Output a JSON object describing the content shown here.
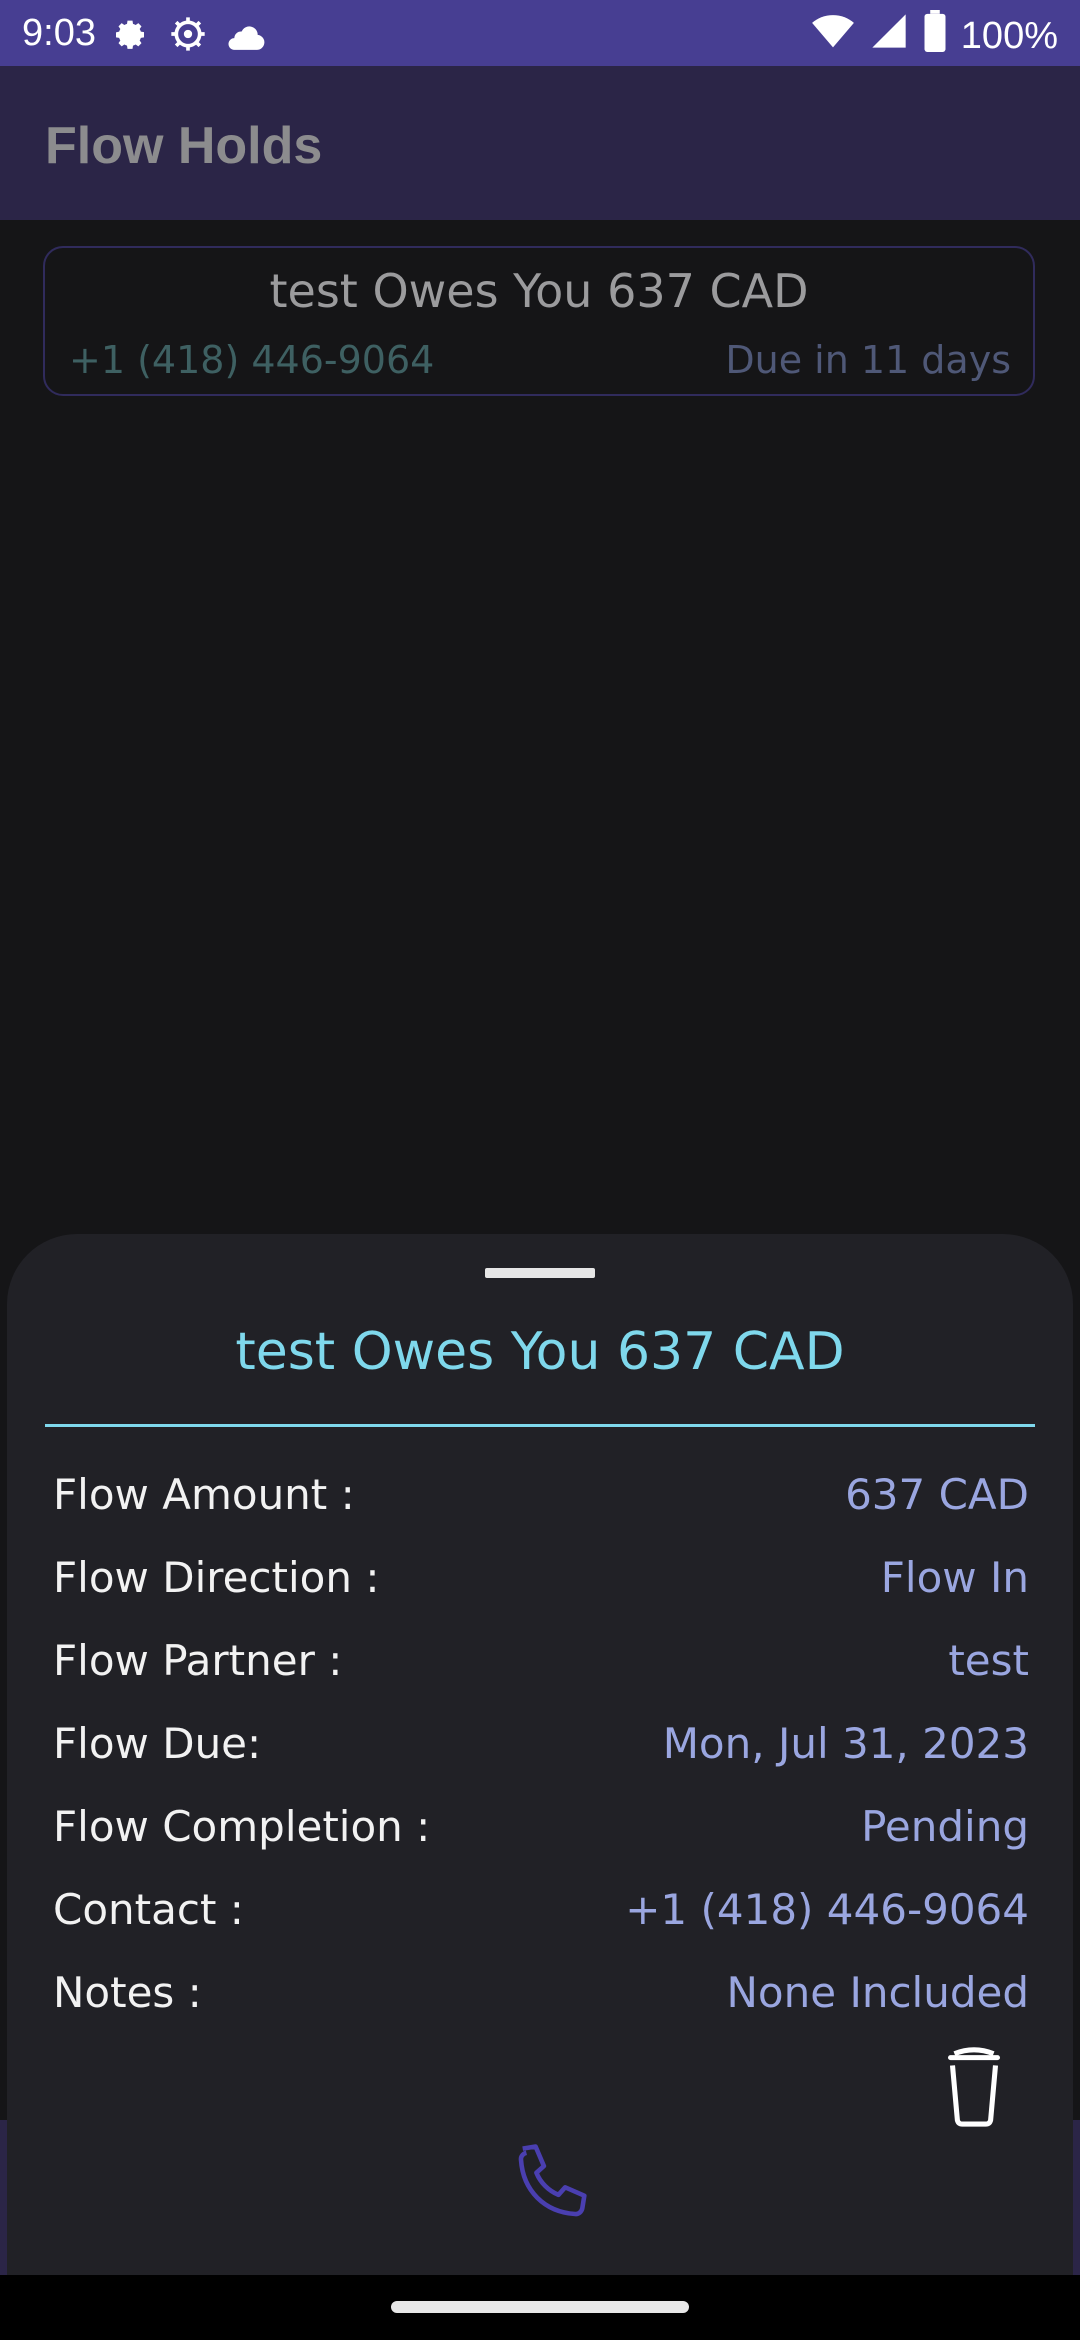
{
  "status_bar": {
    "time": "9:03",
    "battery": "100%",
    "icons_left": [
      "settings-gear-icon",
      "settings-alt-icon",
      "cloud-icon"
    ],
    "icons_right": [
      "wifi-icon",
      "signal-icon",
      "battery-icon"
    ]
  },
  "app_bar": {
    "title": "Flow Holds"
  },
  "hold_card": {
    "title": "test Owes You 637 CAD",
    "phone": "+1 (418) 446-9064",
    "due": "Due in 11 days"
  },
  "sheet": {
    "title": "test Owes You 637 CAD",
    "rows": [
      {
        "label": "Flow Amount :",
        "value": "637 CAD"
      },
      {
        "label": "Flow Direction :",
        "value": "Flow In"
      },
      {
        "label": "Flow Partner :",
        "value": "test"
      },
      {
        "label": "Flow Due:",
        "value": "Mon, Jul 31, 2023"
      },
      {
        "label": "Flow Completion :",
        "value": "Pending"
      },
      {
        "label": "Contact :",
        "value": "+1 (418) 446-9064"
      },
      {
        "label": "Notes :",
        "value": "None Included"
      }
    ],
    "delete_icon": "trash-icon",
    "call_icon": "phone-icon"
  },
  "colors": {
    "status_bar": "#473e92",
    "app_bar": "#2b2547",
    "background": "#151517",
    "sheet": "#212126",
    "accent_cyan": "#7fd8ec",
    "value_text": "#9aa6e0",
    "call_icon": "#4a3fb0"
  }
}
